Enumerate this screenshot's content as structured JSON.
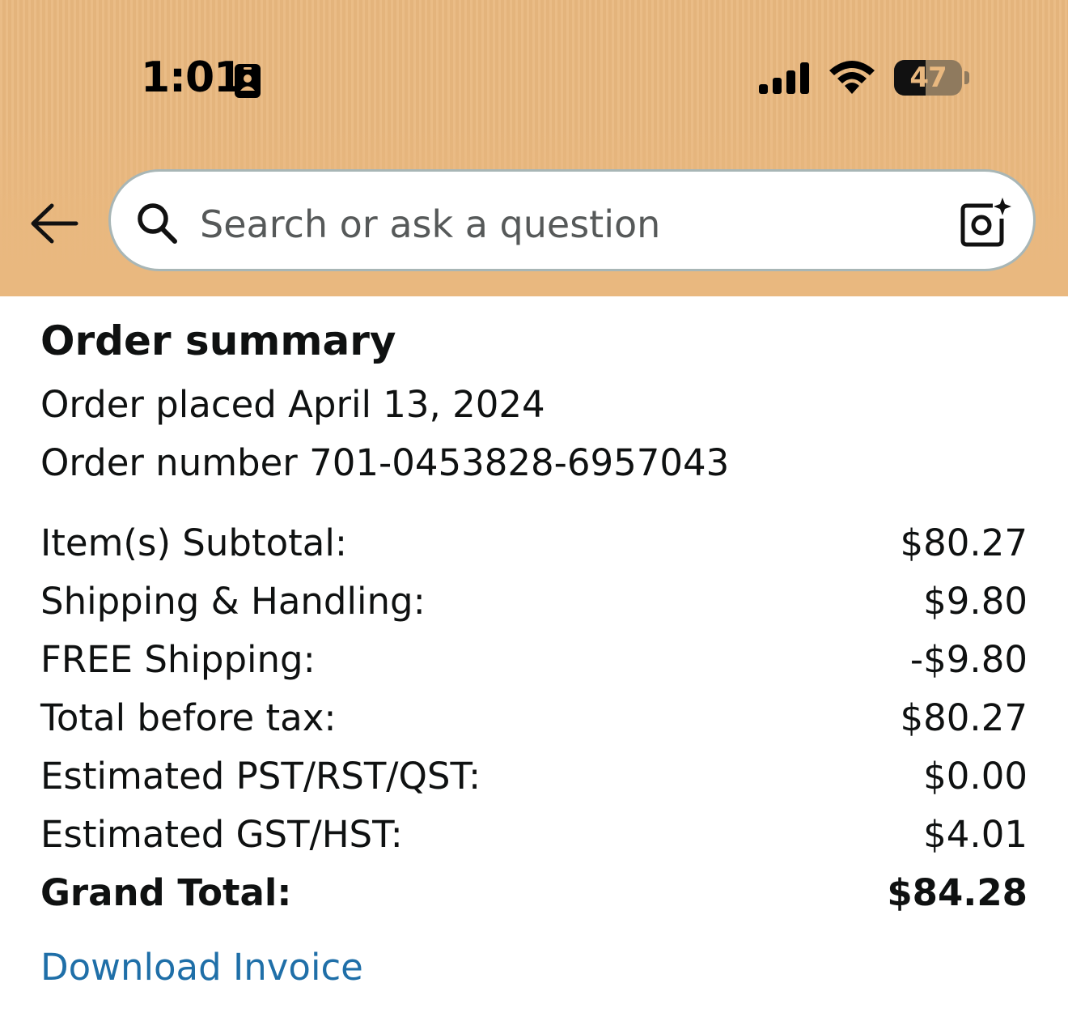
{
  "status_bar": {
    "time": "1:01",
    "battery_level": "47",
    "battery_fraction": 0.47
  },
  "header": {
    "back_icon": "back-arrow-icon",
    "search_placeholder": "Search or ask a question",
    "search_icon": "search-icon",
    "camera_icon": "camera-ai-icon",
    "background_color": "#e9b87f"
  },
  "order": {
    "title": "Order summary",
    "placed": "Order placed April 13, 2024",
    "number": "Order number 701-0453828-6957043"
  },
  "totals": [
    {
      "label": "Item(s) Subtotal:",
      "value": "$80.27"
    },
    {
      "label": "Shipping & Handling:",
      "value": "$9.80"
    },
    {
      "label": "FREE Shipping:",
      "value": "-$9.80"
    },
    {
      "label": "Total before tax:",
      "value": "$80.27"
    },
    {
      "label": "Estimated PST/RST/QST:",
      "value": "$0.00"
    },
    {
      "label": "Estimated GST/HST:",
      "value": "$4.01"
    },
    {
      "label": "Grand Total:",
      "value": "$84.28"
    }
  ],
  "links": {
    "download_invoice": "Download Invoice",
    "link_color": "#1f6fa8"
  }
}
